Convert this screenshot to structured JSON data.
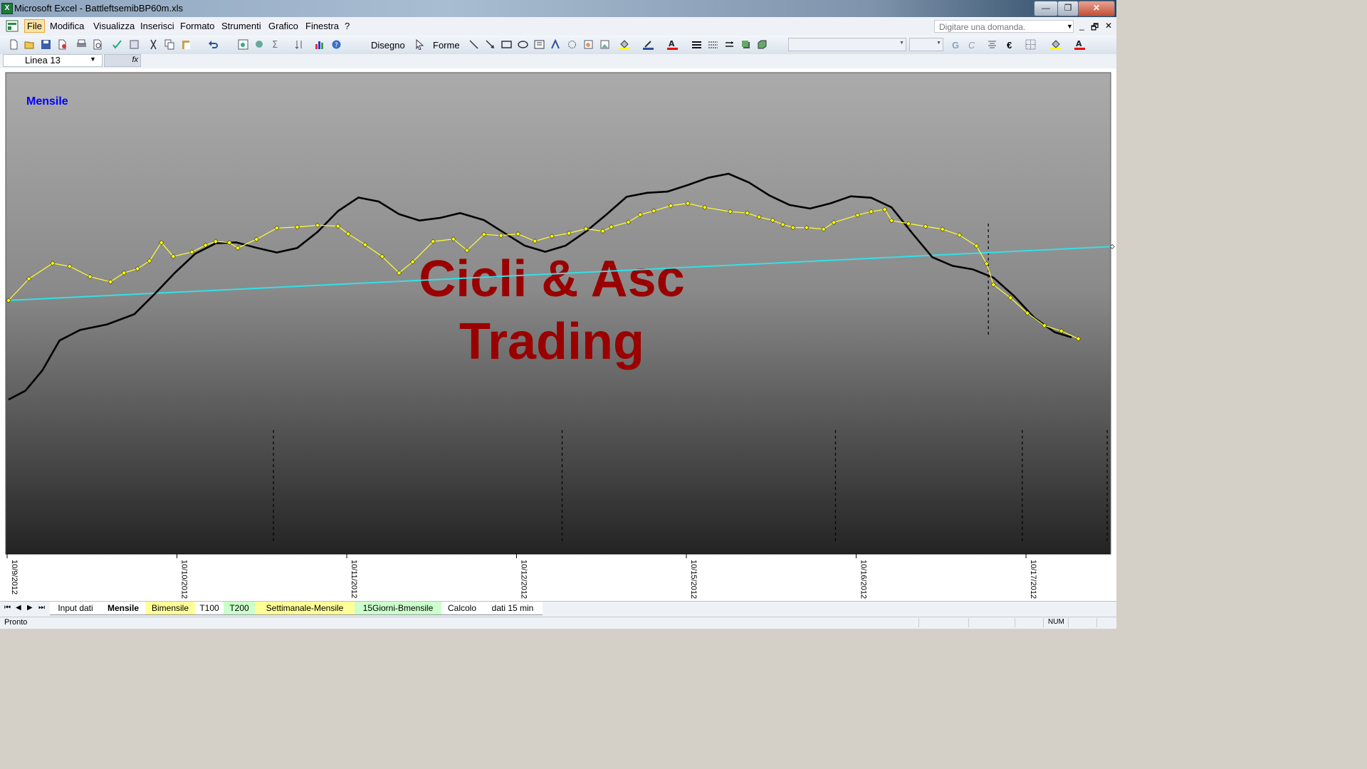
{
  "window": {
    "title": "Microsoft Excel - BattleftsemibBP60m.xls",
    "app_icon": "excel-icon",
    "controls": {
      "minimize": "—",
      "restore": "❐",
      "close": "✕"
    }
  },
  "menu": {
    "items": [
      "File",
      "Modifica",
      "Visualizza",
      "Inserisci",
      "Formato",
      "Strumenti",
      "Grafico",
      "Finestra",
      "?"
    ],
    "ask_placeholder": "Digitare una domanda.",
    "mdi": {
      "minimize": "_",
      "restore": "🗗",
      "close": "✕"
    }
  },
  "toolbar": {
    "drawing_label": "Disegno",
    "shapes_label": "Forme",
    "bold_label": "G",
    "italic_label": "C",
    "euro_label": "€"
  },
  "formula_bar": {
    "name_box": "Linea 13",
    "fx_label": "fx"
  },
  "chart": {
    "colors": {
      "price": "#ffff33",
      "price_marker": "#ffff00",
      "cycle": "#000000",
      "trend": "#33e0e8",
      "watermark": "#9a0000",
      "label": "#0000ff"
    }
  },
  "chart_data": {
    "type": "line",
    "label": "Mensile",
    "watermark": [
      "Cicli & Asc",
      "Trading"
    ],
    "x_tick_labels": [
      "10/9/2012",
      "10/10/2012",
      "10/11/2012",
      "10/12/2012",
      "10/15/2012",
      "10/16/2012",
      "10/17/2012"
    ],
    "x_range": [
      0,
      6.5
    ],
    "y_range": [
      0,
      100
    ],
    "grid": false,
    "series": [
      {
        "role": "price",
        "points": [
          [
            0,
            47.3
          ],
          [
            0.12,
            56.5
          ],
          [
            0.26,
            63.1
          ],
          [
            0.36,
            61.8
          ],
          [
            0.48,
            57.4
          ],
          [
            0.6,
            55.2
          ],
          [
            0.68,
            59.0
          ],
          [
            0.76,
            60.8
          ],
          [
            0.83,
            64.1
          ],
          [
            0.9,
            71.9
          ],
          [
            0.97,
            66.0
          ],
          [
            1.08,
            67.9
          ],
          [
            1.16,
            70.8
          ],
          [
            1.22,
            72.4
          ],
          [
            1.3,
            71.9
          ],
          [
            1.35,
            69.6
          ],
          [
            1.46,
            73.3
          ],
          [
            1.58,
            78.1
          ],
          [
            1.7,
            78.5
          ],
          [
            1.82,
            79.3
          ],
          [
            1.94,
            78.9
          ],
          [
            2.0,
            75.6
          ],
          [
            2.1,
            71.0
          ],
          [
            2.2,
            66.0
          ],
          [
            2.3,
            59.0
          ],
          [
            2.38,
            63.7
          ],
          [
            2.5,
            72.4
          ],
          [
            2.62,
            73.4
          ],
          [
            2.7,
            68.6
          ],
          [
            2.8,
            75.4
          ],
          [
            2.9,
            74.9
          ],
          [
            3.0,
            75.6
          ],
          [
            3.1,
            72.5
          ],
          [
            3.2,
            74.6
          ],
          [
            3.3,
            75.9
          ],
          [
            3.4,
            77.8
          ],
          [
            3.5,
            76.8
          ],
          [
            3.55,
            78.6
          ],
          [
            3.65,
            80.6
          ],
          [
            3.72,
            83.8
          ],
          [
            3.8,
            85.4
          ],
          [
            3.9,
            87.6
          ],
          [
            4.0,
            88.6
          ],
          [
            4.1,
            86.9
          ],
          [
            4.25,
            85.1
          ],
          [
            4.35,
            84.5
          ],
          [
            4.42,
            82.8
          ],
          [
            4.5,
            81.4
          ],
          [
            4.56,
            79.6
          ],
          [
            4.62,
            78.3
          ],
          [
            4.7,
            78.3
          ],
          [
            4.8,
            77.6
          ],
          [
            4.86,
            80.5
          ],
          [
            5.0,
            83.6
          ],
          [
            5.08,
            85.1
          ],
          [
            5.16,
            86.0
          ],
          [
            5.2,
            81.3
          ],
          [
            5.3,
            80.0
          ],
          [
            5.4,
            78.8
          ],
          [
            5.5,
            77.6
          ],
          [
            5.6,
            75.1
          ],
          [
            5.7,
            70.5
          ],
          [
            5.76,
            62.9
          ],
          [
            5.8,
            54.0
          ],
          [
            5.9,
            48.4
          ],
          [
            6.0,
            41.9
          ],
          [
            6.1,
            36.6
          ],
          [
            6.2,
            34.3
          ],
          [
            6.3,
            31.0
          ]
        ]
      },
      {
        "role": "cycle",
        "points": [
          [
            0,
            5.1
          ],
          [
            0.1,
            8.9
          ],
          [
            0.2,
            17.6
          ],
          [
            0.3,
            30.2
          ],
          [
            0.42,
            34.7
          ],
          [
            0.58,
            37.1
          ],
          [
            0.74,
            41.4
          ],
          [
            0.86,
            50.0
          ],
          [
            0.98,
            59.1
          ],
          [
            1.1,
            67.2
          ],
          [
            1.22,
            71.6
          ],
          [
            1.34,
            72.0
          ],
          [
            1.46,
            69.7
          ],
          [
            1.58,
            67.7
          ],
          [
            1.7,
            69.6
          ],
          [
            1.82,
            76.5
          ],
          [
            1.94,
            85.3
          ],
          [
            2.06,
            91.1
          ],
          [
            2.18,
            89.4
          ],
          [
            2.3,
            84.0
          ],
          [
            2.42,
            81.3
          ],
          [
            2.54,
            82.4
          ],
          [
            2.66,
            84.5
          ],
          [
            2.8,
            81.5
          ],
          [
            2.92,
            76.0
          ],
          [
            3.04,
            70.6
          ],
          [
            3.16,
            68.0
          ],
          [
            3.28,
            70.6
          ],
          [
            3.4,
            76.6
          ],
          [
            3.52,
            83.8
          ],
          [
            3.64,
            91.4
          ],
          [
            3.76,
            93.1
          ],
          [
            3.88,
            93.6
          ],
          [
            4.0,
            96.4
          ],
          [
            4.12,
            99.5
          ],
          [
            4.24,
            101.2
          ],
          [
            4.36,
            97.5
          ],
          [
            4.48,
            92.0
          ],
          [
            4.6,
            87.9
          ],
          [
            4.72,
            86.4
          ],
          [
            4.84,
            88.6
          ],
          [
            4.96,
            91.6
          ],
          [
            5.08,
            91.0
          ],
          [
            5.2,
            86.9
          ],
          [
            5.32,
            76.1
          ],
          [
            5.44,
            65.7
          ],
          [
            5.56,
            62.0
          ],
          [
            5.68,
            60.5
          ],
          [
            5.8,
            57.0
          ],
          [
            5.92,
            49.3
          ],
          [
            6.04,
            40.0
          ],
          [
            6.16,
            33.8
          ],
          [
            6.26,
            31.6
          ]
        ]
      },
      {
        "role": "trend",
        "points": [
          [
            0,
            47.3
          ],
          [
            6.5,
            70.2
          ]
        ]
      }
    ],
    "cycle_bottom_markers": [
      1.56,
      3.26,
      4.87,
      5.97,
      6.47
    ],
    "cycle_mid_markers": [
      5.77
    ]
  },
  "sheet_tabs": {
    "nav": [
      "⏮",
      "◀",
      "▶",
      "⏭"
    ],
    "tabs": [
      {
        "label": "Input dati",
        "color": "#ffffff",
        "active": false
      },
      {
        "label": "Mensile",
        "color": "#ffffff",
        "active": true
      },
      {
        "label": "Bimensile",
        "color": "#ffff99",
        "active": false
      },
      {
        "label": "T100",
        "color": "#ffffff",
        "active": false
      },
      {
        "label": "T200",
        "color": "#ccffcc",
        "active": false
      },
      {
        "label": "Settimanale-Mensile",
        "color": "#ffff99",
        "active": false
      },
      {
        "label": "15Giorni-Bmensile",
        "color": "#ccffcc",
        "active": false
      },
      {
        "label": "Calcolo",
        "color": "#ffffff",
        "active": false
      },
      {
        "label": "dati 15 min",
        "color": "#ffffff",
        "active": false
      }
    ]
  },
  "status": {
    "text": "Pronto",
    "num": "NUM"
  }
}
